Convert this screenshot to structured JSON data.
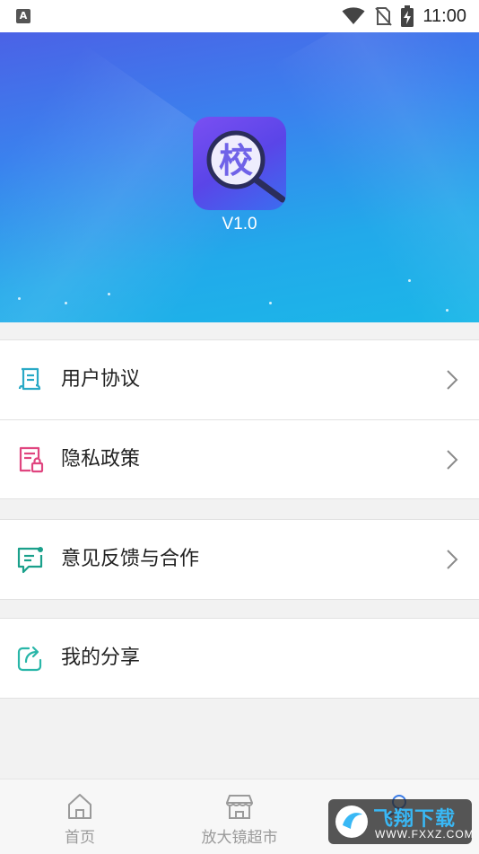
{
  "status_bar": {
    "time": "11:00",
    "notification_icon_letter": "A"
  },
  "hero": {
    "version": "V1.0",
    "logo_text": "校",
    "colors": {
      "top": "#4b62e6",
      "bottom": "#1bb7e8"
    }
  },
  "menu": {
    "group1": [
      {
        "label": "用户协议",
        "icon": "agreement-document-icon",
        "color": "#29a9c6"
      },
      {
        "label": "隐私政策",
        "icon": "privacy-lock-document-icon",
        "color": "#e0457f"
      }
    ],
    "group2": [
      {
        "label": "意见反馈与合作",
        "icon": "feedback-chat-icon",
        "color": "#1aa08b"
      }
    ],
    "group3": [
      {
        "label": "我的分享",
        "icon": "share-icon",
        "color": "#29b6a8"
      }
    ]
  },
  "tabbar": [
    {
      "label": "首页",
      "icon": "home-icon"
    },
    {
      "label": "放大镜超市",
      "icon": "store-icon"
    },
    {
      "label": "",
      "icon": "profile-icon"
    }
  ],
  "watermark": {
    "title": "飞翔下载",
    "url": "WWW.FXXZ.COM"
  }
}
